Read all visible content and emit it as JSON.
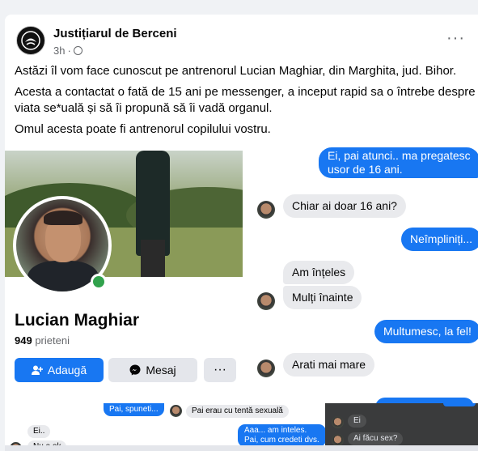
{
  "post": {
    "page_name": "Justițiarul de Berceni",
    "time": "3h",
    "more_label": "···",
    "paragraphs": [
      "Astăzi îl vom face cunoscut pe antrenorul Lucian Maghiar, din Marghita, jud. Bihor.",
      "Acesta a contactat o fată de 15 ani pe messenger, a inceput rapid sa o întrebe despre viata se*uală și să îi propună să îi vadă organul.",
      "Omul acesta poate fi antrenorul copilului vostru."
    ]
  },
  "profile": {
    "name": "Lucian Maghiar",
    "friends_count": "949",
    "friends_label": "prieteni",
    "add_label": "Adaugă",
    "message_label": "Mesaj",
    "more_label": "···"
  },
  "chat": {
    "messages": [
      {
        "dir": "out",
        "text": "Ei, pai atunci.. ma pregatesc"
      },
      {
        "dir": "out",
        "text": "usor de 16 ani."
      },
      {
        "dir": "in",
        "text": "Chiar ai doar 16 ani?"
      },
      {
        "dir": "out",
        "text": "Neîmpliniți..."
      },
      {
        "dir": "in",
        "text": "Am înțeles"
      },
      {
        "dir": "in",
        "text": "Mulți înainte"
      },
      {
        "dir": "out",
        "text": "Multumesc, la fel!"
      },
      {
        "dir": "in",
        "text": "Arati mai mare"
      }
    ]
  },
  "strip": {
    "s1": "Pai, spuneti...",
    "s2": "Pai erau cu tentă sexuală",
    "s3": "Ei..",
    "s4": "Nu e ok",
    "s5a": "Aaa... am inteles.",
    "s5b": "Pai, cum credeti dvs.",
    "s6": "Ei",
    "s7": "Ai făcu sex?"
  },
  "colors": {
    "accent": "#1877f2",
    "incoming_bubble": "#e9eaed",
    "online": "#31a24c"
  },
  "icons": [
    "page-logo-icon",
    "globe-icon",
    "more-icon",
    "add-friend-icon",
    "messenger-icon"
  ]
}
